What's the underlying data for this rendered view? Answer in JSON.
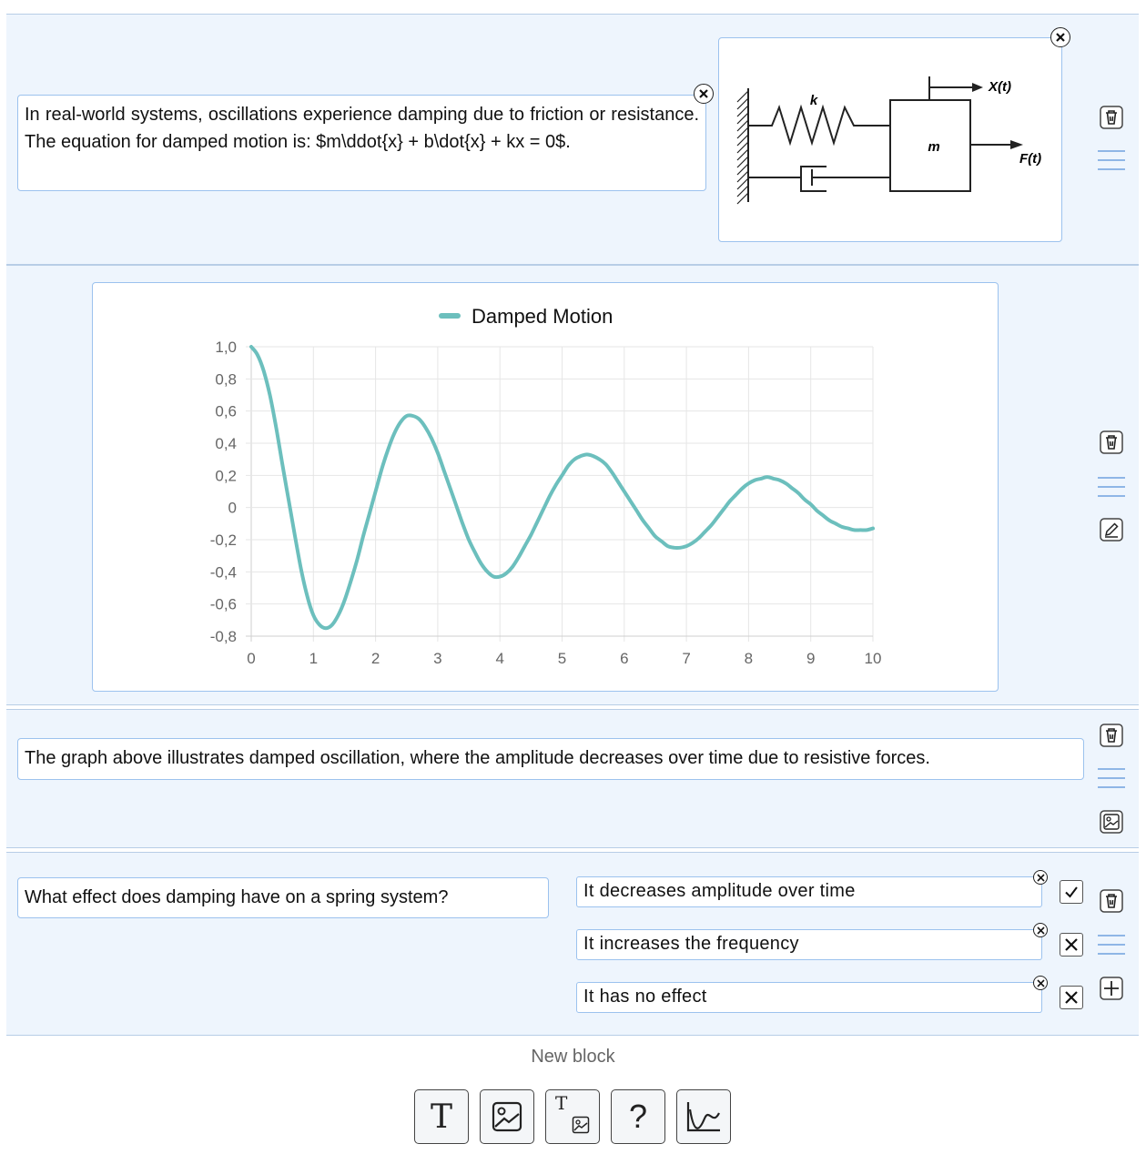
{
  "blocks": {
    "intro": {
      "text": "In real-world systems, oscillations experience damping due to friction or resistance. The equation for damped motion is: $m\\ddot{x} + b\\dot{x} + kx = 0$.",
      "diagram": {
        "label_k": "k",
        "label_m": "m",
        "label_x": "X(t)",
        "label_f": "F(t)"
      }
    },
    "chart": {
      "legend": "Damped Motion"
    },
    "caption": {
      "text": "The graph above illustrates damped oscillation, where the amplitude decreases over time due to resistive forces."
    },
    "quiz": {
      "question": "What effect does damping have on a spring system?",
      "answers": [
        {
          "label": "It decreases amplitude over time",
          "correct": true
        },
        {
          "label": "It increases the frequency",
          "correct": false
        },
        {
          "label": "It has no effect",
          "correct": false
        }
      ]
    }
  },
  "new_block": {
    "label": "New block",
    "tools": [
      "text-block",
      "image-block",
      "text-image-block",
      "question-block",
      "chart-block"
    ],
    "text_tool_glyph": "T",
    "text_image_tool_glyph": "T",
    "question_tool_glyph": "?"
  },
  "chart_data": {
    "type": "line",
    "title": "",
    "xlabel": "",
    "ylabel": "",
    "series": [
      {
        "name": "Damped Motion",
        "color": "#6cbfbd",
        "x": [
          0,
          0.1,
          0.2,
          0.3,
          0.4,
          0.5,
          0.6,
          0.7,
          0.8,
          0.9,
          1.0,
          1.1,
          1.2,
          1.3,
          1.4,
          1.5,
          1.6,
          1.7,
          1.8,
          1.9,
          2.0,
          2.1,
          2.2,
          2.3,
          2.4,
          2.5,
          2.6,
          2.7,
          2.8,
          2.9,
          3.0,
          3.1,
          3.2,
          3.3,
          3.4,
          3.5,
          3.6,
          3.7,
          3.8,
          3.9,
          4.0,
          4.1,
          4.2,
          4.3,
          4.4,
          4.5,
          4.6,
          4.7,
          4.8,
          4.9,
          5.0,
          5.1,
          5.2,
          5.3,
          5.4,
          5.5,
          5.6,
          5.7,
          5.8,
          5.9,
          6.0,
          6.1,
          6.2,
          6.3,
          6.4,
          6.5,
          6.6,
          6.7,
          6.8,
          6.9,
          7.0,
          7.1,
          7.2,
          7.3,
          7.4,
          7.5,
          7.6,
          7.7,
          7.8,
          7.9,
          8.0,
          8.1,
          8.2,
          8.3,
          8.4,
          8.5,
          8.6,
          8.7,
          8.8,
          8.9,
          9.0,
          9.1,
          9.2,
          9.3,
          9.4,
          9.5,
          9.6,
          9.7,
          9.8,
          9.9,
          10.0
        ],
        "y": [
          1.0,
          0.95,
          0.85,
          0.7,
          0.5,
          0.27,
          0.05,
          -0.17,
          -0.38,
          -0.55,
          -0.67,
          -0.73,
          -0.75,
          -0.73,
          -0.67,
          -0.58,
          -0.46,
          -0.33,
          -0.18,
          -0.04,
          0.1,
          0.24,
          0.36,
          0.46,
          0.53,
          0.57,
          0.57,
          0.55,
          0.5,
          0.43,
          0.34,
          0.23,
          0.12,
          0.01,
          -0.1,
          -0.2,
          -0.28,
          -0.35,
          -0.4,
          -0.43,
          -0.43,
          -0.41,
          -0.37,
          -0.31,
          -0.24,
          -0.17,
          -0.09,
          -0.01,
          0.07,
          0.14,
          0.2,
          0.26,
          0.3,
          0.32,
          0.33,
          0.32,
          0.3,
          0.27,
          0.22,
          0.16,
          0.1,
          0.04,
          -0.02,
          -0.08,
          -0.13,
          -0.18,
          -0.21,
          -0.24,
          -0.25,
          -0.25,
          -0.24,
          -0.22,
          -0.19,
          -0.15,
          -0.11,
          -0.06,
          -0.01,
          0.04,
          0.08,
          0.12,
          0.15,
          0.17,
          0.18,
          0.19,
          0.18,
          0.17,
          0.15,
          0.12,
          0.09,
          0.05,
          0.02,
          -0.02,
          -0.05,
          -0.08,
          -0.1,
          -0.12,
          -0.13,
          -0.14,
          -0.14,
          -0.14,
          -0.13
        ]
      }
    ],
    "xlim": [
      0,
      10
    ],
    "ylim": [
      -0.8,
      1.0
    ],
    "x_ticks": [
      "0",
      "1",
      "2",
      "3",
      "4",
      "5",
      "6",
      "7",
      "8",
      "9",
      "10"
    ],
    "y_ticks": [
      "1,0",
      "0,8",
      "0,6",
      "0,4",
      "0,2",
      "0",
      "-0,2",
      "-0,4",
      "-0,6",
      "-0,8"
    ],
    "grid": true,
    "legend_position": "top"
  }
}
